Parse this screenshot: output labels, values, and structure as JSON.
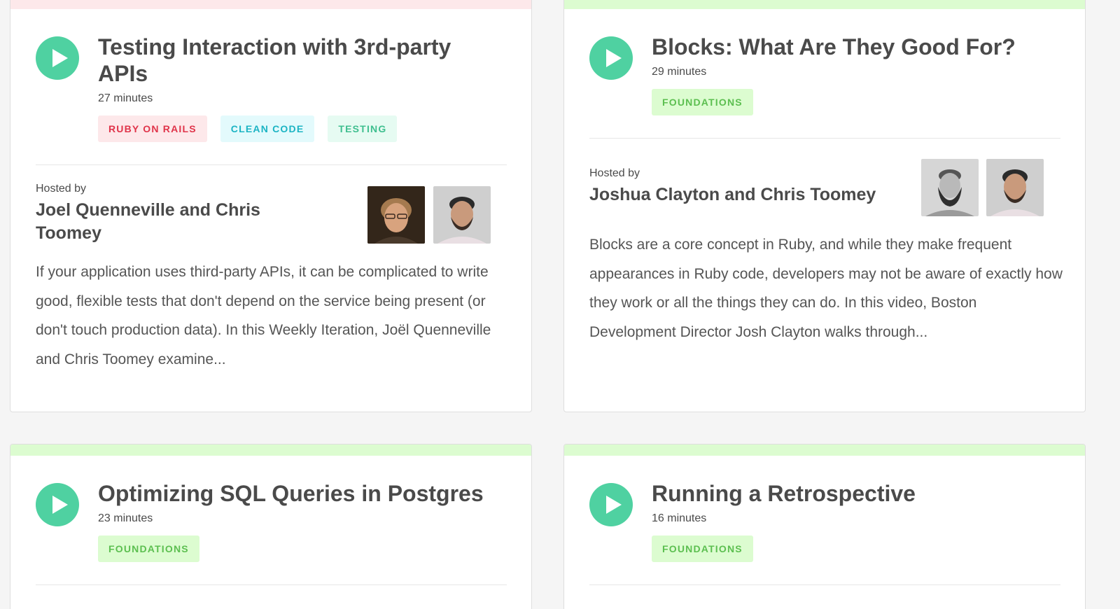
{
  "colors": {
    "play": "#4fd1a1",
    "bar_pink": "#fde8ea",
    "bar_green": "#dcfcd0",
    "tag_ruby_bg": "#fde8ea",
    "tag_ruby_fg": "#e0344a",
    "tag_clean_bg": "#e3fafc",
    "tag_clean_fg": "#1cb4c4",
    "tag_testing_bg": "#e6fbf2",
    "tag_testing_fg": "#3fbf8f",
    "tag_foundations_bg": "#dcfcd0",
    "tag_foundations_fg": "#5cbf50"
  },
  "cards": [
    {
      "title": "Testing Interaction with 3rd-party APIs",
      "duration": "27 minutes",
      "tags": [
        "RUBY ON RAILS",
        "CLEAN CODE",
        "TESTING"
      ],
      "hosted_by_label": "Hosted by",
      "hosts": "Joel Quenneville and Chris Toomey",
      "description": "If your application uses third-party APIs, it can be complicated to write good, flexible tests that don't depend on the service being present (or don't touch production data). In this Weekly Iteration, Joël Quenneville and Chris Toomey examine..."
    },
    {
      "title": "Blocks: What Are They Good For?",
      "duration": "29 minutes",
      "tags": [
        "FOUNDATIONS"
      ],
      "hosted_by_label": "Hosted by",
      "hosts": "Joshua Clayton and Chris Toomey",
      "description": "Blocks are a core concept in Ruby, and while they make frequent appearances in Ruby code, developers may not be aware of exactly how they work or all the things they can do. In this video, Boston Development Director Josh Clayton walks through..."
    },
    {
      "title": "Optimizing SQL Queries in Postgres",
      "duration": "23 minutes",
      "tags": [
        "FOUNDATIONS"
      ]
    },
    {
      "title": "Running a Retrospective",
      "duration": "16 minutes",
      "tags": [
        "FOUNDATIONS"
      ]
    }
  ]
}
